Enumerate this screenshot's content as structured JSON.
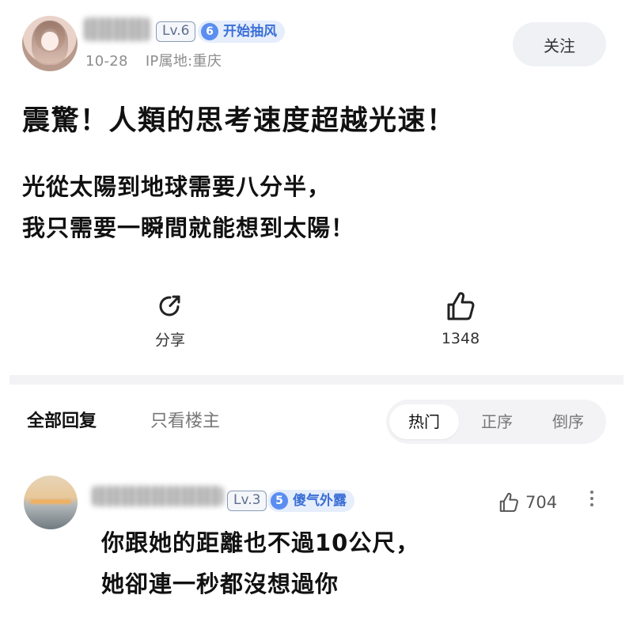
{
  "post": {
    "author_level": "Lv.6",
    "medal_number": "6",
    "medal_label": "开始抽风",
    "date": "10-28",
    "ip_location": "IP属地:重庆",
    "follow_label": "关注",
    "title": "震驚！人類的思考速度超越光速！",
    "body_line1": "光從太陽到地球需要八分半，",
    "body_line2": "我只需要一瞬間就能想到太陽！",
    "share_label": "分享",
    "like_count": "1348"
  },
  "tabs": {
    "all_replies": "全部回复",
    "op_only": "只看楼主"
  },
  "sort": {
    "hot": "热门",
    "ascending": "正序",
    "descending": "倒序",
    "selected": "热门"
  },
  "comment": {
    "author_level": "Lv.3",
    "medal_number": "5",
    "medal_label": "傻气外露",
    "like_count": "704",
    "text_line1": "你跟她的距離也不過10公尺，",
    "text_line2": "她卻連一秒都沒想過你"
  },
  "icons": {
    "share": "share-icon",
    "like": "thumbs-up-icon",
    "more": "more-vertical-icon"
  }
}
